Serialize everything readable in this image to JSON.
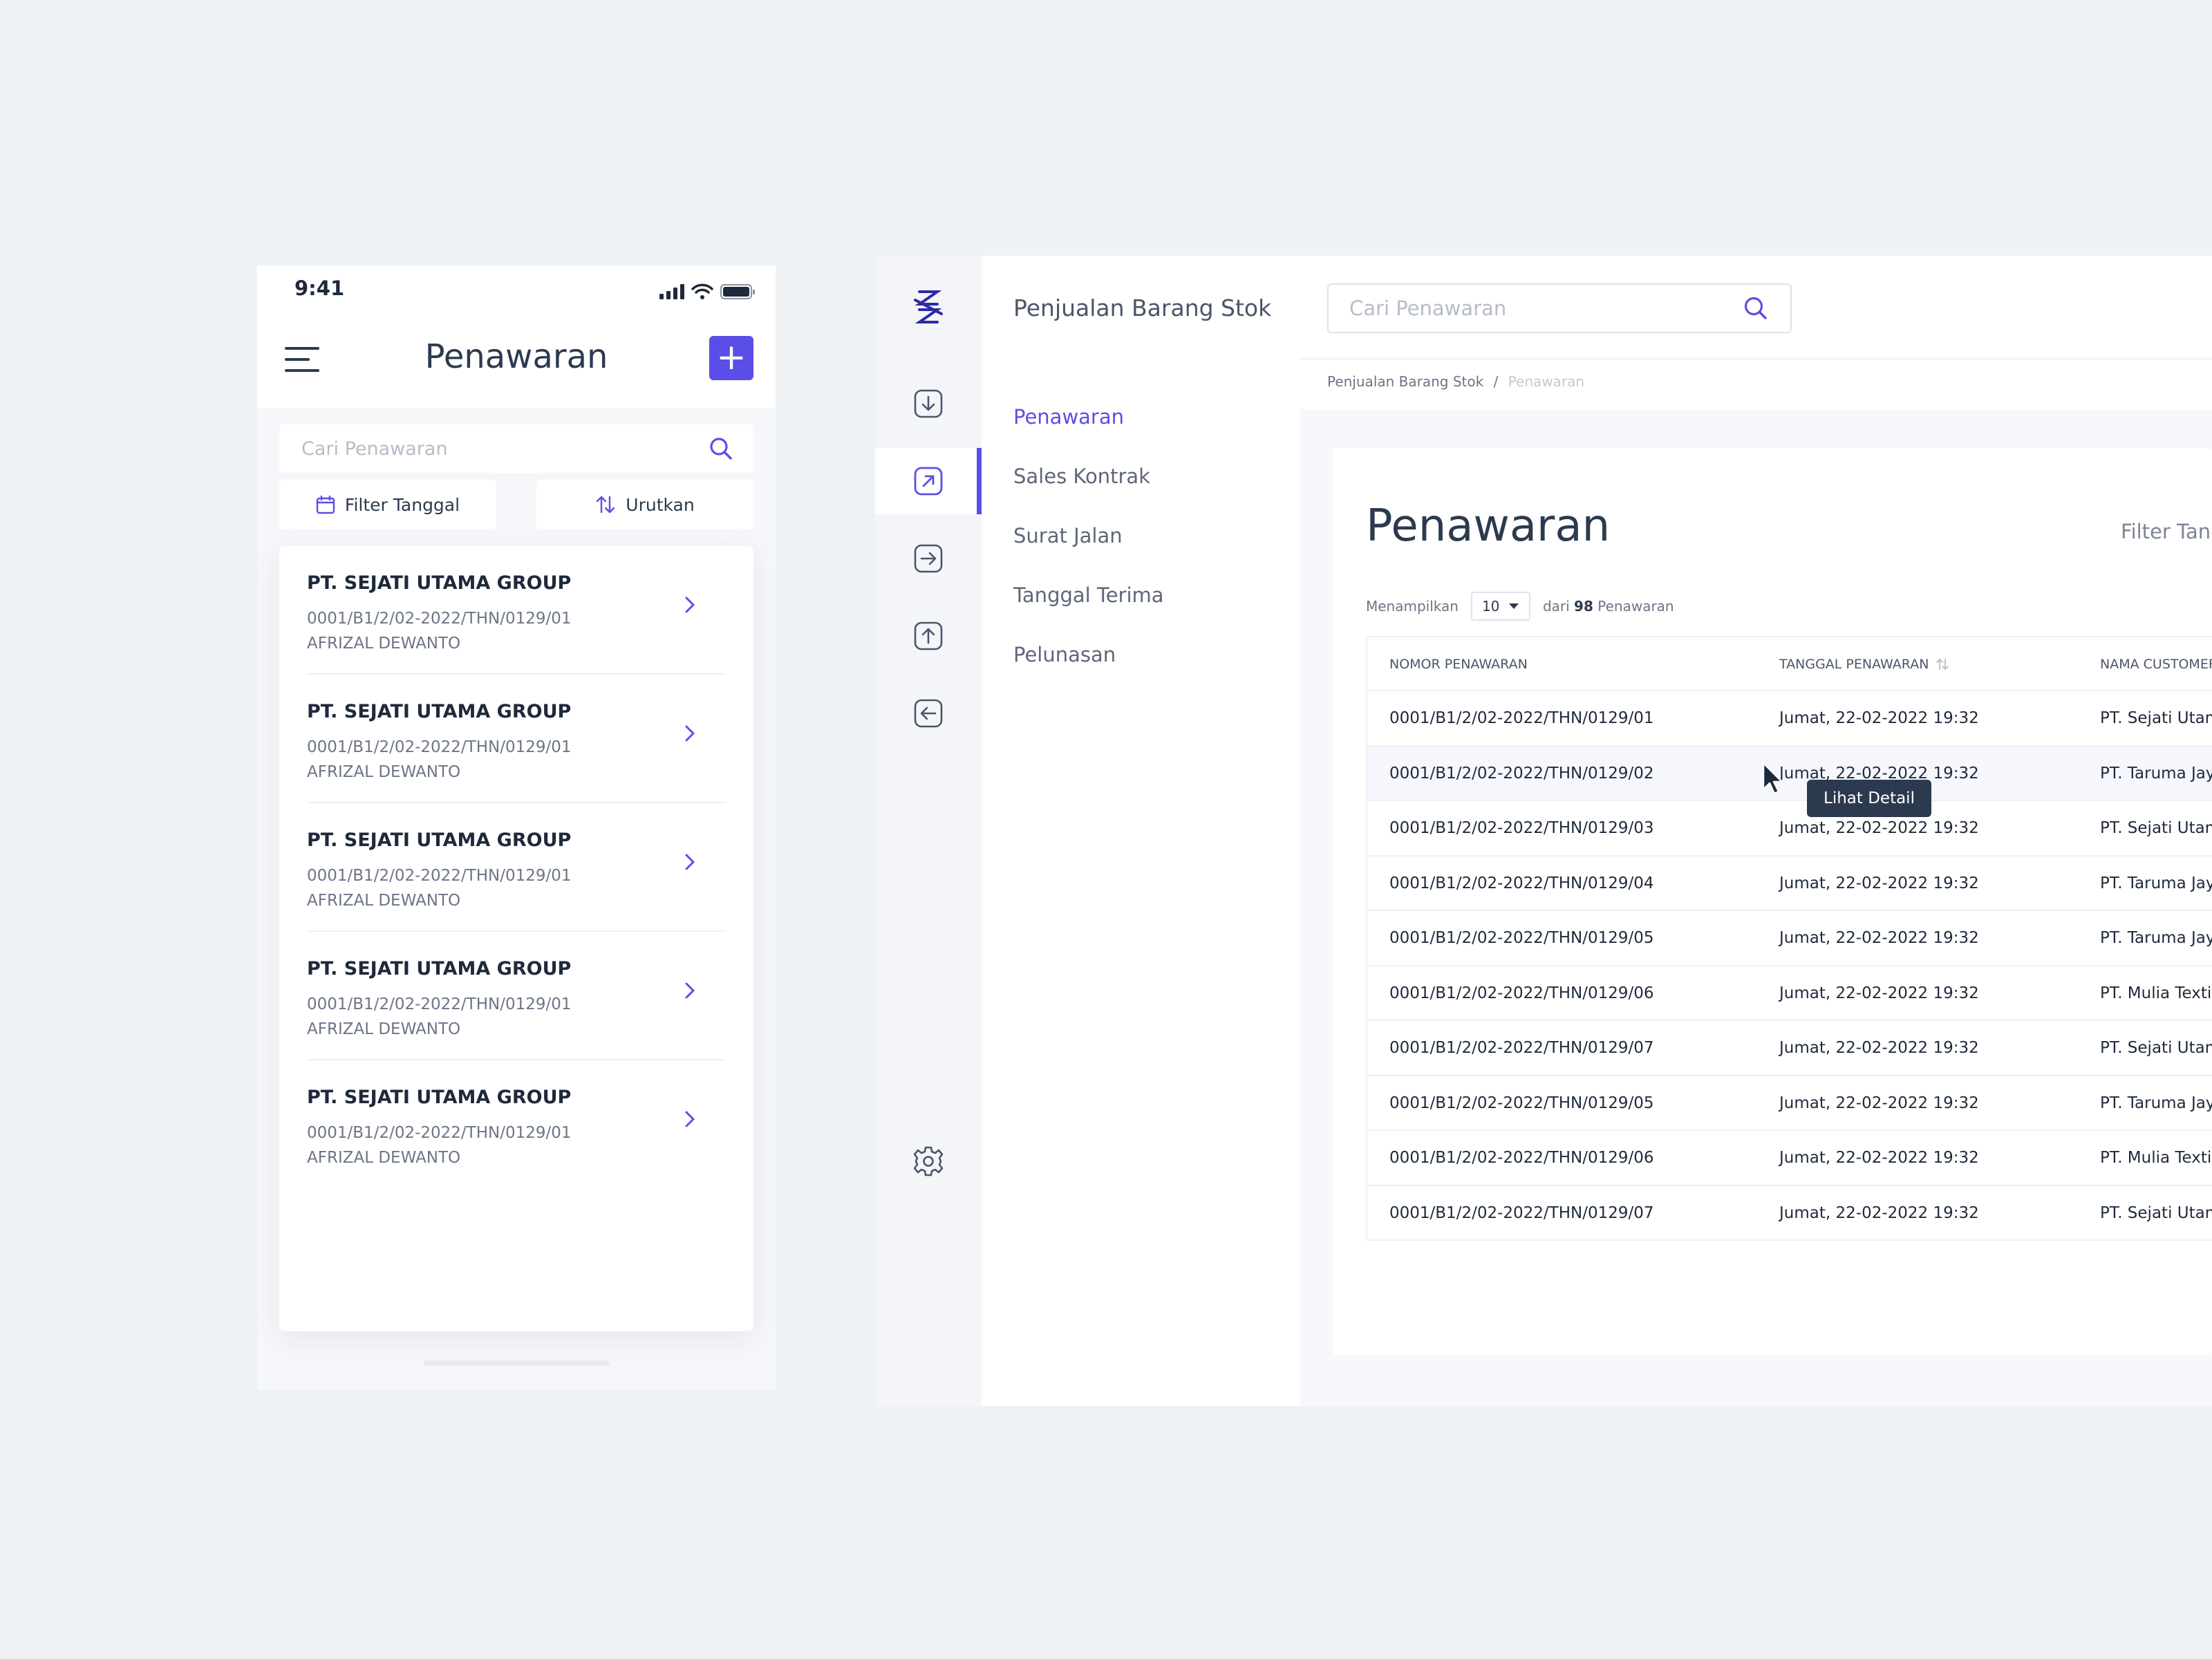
{
  "mobile": {
    "status": {
      "time": "9:41"
    },
    "header": {
      "title": "Penawaran"
    },
    "search": {
      "placeholder": "Cari Penawaran"
    },
    "filter_label": "Filter Tanggal",
    "sort_label": "Urutkan",
    "items": [
      {
        "company": "PT. SEJATI UTAMA GROUP",
        "number": "0001/B1/2/02-2022/THN/0129/01",
        "person": "AFRIZAL DEWANTO"
      },
      {
        "company": "PT. SEJATI UTAMA GROUP",
        "number": "0001/B1/2/02-2022/THN/0129/01",
        "person": "AFRIZAL DEWANTO"
      },
      {
        "company": "PT. SEJATI UTAMA GROUP",
        "number": "0001/B1/2/02-2022/THN/0129/01",
        "person": "AFRIZAL DEWANTO"
      },
      {
        "company": "PT. SEJATI UTAMA GROUP",
        "number": "0001/B1/2/02-2022/THN/0129/01",
        "person": "AFRIZAL DEWANTO"
      },
      {
        "company": "PT. SEJATI UTAMA GROUP",
        "number": "0001/B1/2/02-2022/THN/0129/01",
        "person": "AFRIZAL DEWANTO"
      }
    ]
  },
  "desktop": {
    "rail_icons": [
      "logo-icon",
      "download-icon",
      "arrow-up-right-icon",
      "arrow-right-icon",
      "arrow-up-icon",
      "arrow-left-icon",
      "gear-icon"
    ],
    "app_title": "Penjualan Barang Stok",
    "search": {
      "placeholder": "Cari Penawaran"
    },
    "breadcrumb": {
      "parent": "Penjualan Barang Stok",
      "separator": "/",
      "current": "Penawaran"
    },
    "nav": [
      "Penawaran",
      "Sales Kontrak",
      "Surat Jalan",
      "Tanggal Terima",
      "Pelunasan"
    ],
    "page_title": "Penawaran",
    "filter_label": "Filter Tang",
    "showing": {
      "prefix": "Menampilkan",
      "per_page": "10",
      "of_word": "dari",
      "total": "98",
      "suffix": "Penawaran"
    },
    "columns": [
      "NOMOR PENAWARAN",
      "TANGGAL PENAWARAN",
      "NAMA CUSTOMER"
    ],
    "rows": [
      {
        "number": "0001/B1/2/02-2022/THN/0129/01",
        "date": "Jumat, 22-02-2022 19:32",
        "customer": "PT. Sejati Utam"
      },
      {
        "number": "0001/B1/2/02-2022/THN/0129/02",
        "date": "Jumat, 22-02-2022 19:32",
        "customer": "PT. Taruma Jay"
      },
      {
        "number": "0001/B1/2/02-2022/THN/0129/03",
        "date": "Jumat, 22-02-2022 19:32",
        "customer": "PT. Sejati Utam"
      },
      {
        "number": "0001/B1/2/02-2022/THN/0129/04",
        "date": "Jumat, 22-02-2022 19:32",
        "customer": "PT. Taruma Jay"
      },
      {
        "number": "0001/B1/2/02-2022/THN/0129/05",
        "date": "Jumat, 22-02-2022 19:32",
        "customer": "PT. Taruma Jay"
      },
      {
        "number": "0001/B1/2/02-2022/THN/0129/06",
        "date": "Jumat, 22-02-2022 19:32",
        "customer": "PT. Mulia Textil"
      },
      {
        "number": "0001/B1/2/02-2022/THN/0129/07",
        "date": "Jumat, 22-02-2022 19:32",
        "customer": "PT. Sejati Utam"
      },
      {
        "number": "0001/B1/2/02-2022/THN/0129/05",
        "date": "Jumat, 22-02-2022 19:32",
        "customer": "PT. Taruma Jay"
      },
      {
        "number": "0001/B1/2/02-2022/THN/0129/06",
        "date": "Jumat, 22-02-2022 19:32",
        "customer": "PT. Mulia Textil"
      },
      {
        "number": "0001/B1/2/02-2022/THN/0129/07",
        "date": "Jumat, 22-02-2022 19:32",
        "customer": "PT. Sejati Utam"
      }
    ],
    "tooltip": "Lihat Detail"
  },
  "colors": {
    "accent": "#5b4ee8",
    "text": "#1e2a3b",
    "muted": "#6c7586",
    "background": "#eff2f5"
  }
}
